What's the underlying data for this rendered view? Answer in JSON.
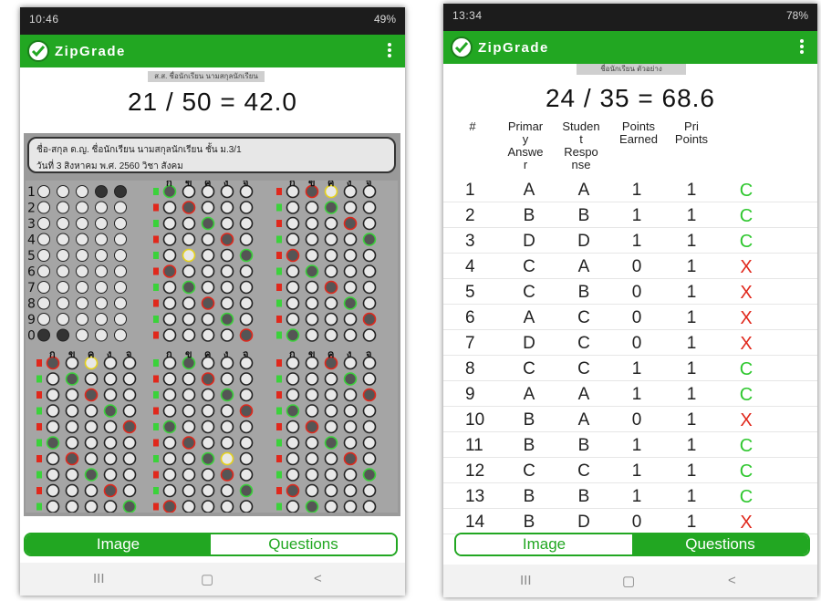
{
  "left": {
    "status": {
      "time": "10:46",
      "battery": "49%"
    },
    "app_title": "ZipGrade",
    "student_strip": "ส.ส. ชื่อนักเรียน นามสกุลนักเรียน",
    "score_text": "21 / 50 = 42.0",
    "sheet": {
      "row1": "ชื่อ-สกุล  ด.ญ. ชื่อนักเรียน  นามสกุลนักเรียน        ชั้น   ม.3/1",
      "row2": "วันที่  3 สิงหาคม  พ.ศ. 2560        วิชา  สังคม",
      "id_header": "เลขที่",
      "choice_header": [
        "ก",
        "ข",
        "ค",
        "ง",
        "จ"
      ]
    },
    "tabs": {
      "image": "Image",
      "questions": "Questions",
      "active": "image"
    },
    "nav": {
      "recent": "III",
      "home": "▢",
      "back": "<"
    }
  },
  "right": {
    "status": {
      "time": "13:34",
      "battery": "78%"
    },
    "app_title": "ZipGrade",
    "student_strip": "ชื่อนักเรียน  ตัวอย่าง",
    "score_text": "24 / 35 = 68.6",
    "headers": {
      "num": "#",
      "primary": [
        "Primar",
        "y",
        "Answe",
        "r"
      ],
      "student": [
        "Studen",
        "t",
        "Respo",
        "nse"
      ],
      "earned": [
        "Points",
        "Earned"
      ],
      "pri_points": [
        "Pri",
        "Points"
      ]
    },
    "rows": [
      {
        "num": "1",
        "answer": "A",
        "response": "A",
        "earned": "1",
        "points": "1",
        "result": "C"
      },
      {
        "num": "2",
        "answer": "B",
        "response": "B",
        "earned": "1",
        "points": "1",
        "result": "C"
      },
      {
        "num": "3",
        "answer": "D",
        "response": "D",
        "earned": "1",
        "points": "1",
        "result": "C"
      },
      {
        "num": "4",
        "answer": "C",
        "response": "A",
        "earned": "0",
        "points": "1",
        "result": "X"
      },
      {
        "num": "5",
        "answer": "C",
        "response": "B",
        "earned": "0",
        "points": "1",
        "result": "X"
      },
      {
        "num": "6",
        "answer": "A",
        "response": "C",
        "earned": "0",
        "points": "1",
        "result": "X"
      },
      {
        "num": "7",
        "answer": "D",
        "response": "C",
        "earned": "0",
        "points": "1",
        "result": "X"
      },
      {
        "num": "8",
        "answer": "C",
        "response": "C",
        "earned": "1",
        "points": "1",
        "result": "C"
      },
      {
        "num": "9",
        "answer": "A",
        "response": "A",
        "earned": "1",
        "points": "1",
        "result": "C"
      },
      {
        "num": "10",
        "answer": "B",
        "response": "A",
        "earned": "0",
        "points": "1",
        "result": "X"
      },
      {
        "num": "11",
        "answer": "B",
        "response": "B",
        "earned": "1",
        "points": "1",
        "result": "C"
      },
      {
        "num": "12",
        "answer": "C",
        "response": "C",
        "earned": "1",
        "points": "1",
        "result": "C"
      },
      {
        "num": "13",
        "answer": "B",
        "response": "B",
        "earned": "1",
        "points": "1",
        "result": "C"
      },
      {
        "num": "14",
        "answer": "B",
        "response": "D",
        "earned": "0",
        "points": "1",
        "result": "X"
      }
    ],
    "tabs": {
      "image": "Image",
      "questions": "Questions",
      "active": "questions"
    },
    "nav": {
      "recent": "III",
      "home": "▢",
      "back": "<"
    }
  },
  "colors": {
    "brand_green": "#22a722",
    "correct": "#2ec72e",
    "incorrect": "#e0281c",
    "sheet_gray": "#9a9a9a"
  }
}
